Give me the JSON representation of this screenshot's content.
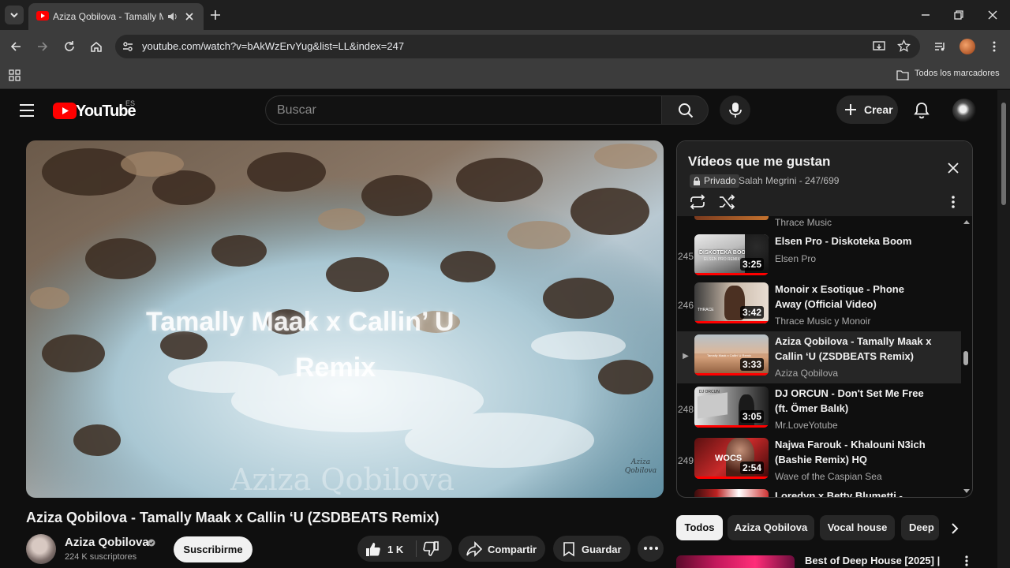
{
  "browser": {
    "tab_title": "Aziza Qobilova - Tamally Maak x Callin ‘U (ZSDBEATS Remix)",
    "url": "youtube.com/watch?v=bAkWzErvYug&list=LL&index=247",
    "bookmarks_label": "Todos los marcadores"
  },
  "header": {
    "logo_text": "YouTube",
    "region": "ES",
    "search_placeholder": "Buscar",
    "create_label": "Crear"
  },
  "video": {
    "overlay_line1": "Tamally Maak x Callin’ U",
    "overlay_line2": "Remix",
    "watermark": "Aziza Qobilova",
    "corner_mark": "Aziza Qobilova",
    "title": "Aziza Qobilova - Tamally Maak x Callin ‘U (ZSDBEATS Remix)",
    "channel": "Aziza Qobilova",
    "subscribers": "224 K suscriptores",
    "subscribe_label": "Suscribirme",
    "like_count": "1 K",
    "share_label": "Compartir",
    "save_label": "Guardar"
  },
  "playlist": {
    "title": "Vídeos que me gustan",
    "privacy": "Privado",
    "owner_position": "Salah Megrini - 247/699",
    "top_partial_channel": "Thrace Music",
    "items": [
      {
        "index": "245",
        "title": "Elsen Pro - Diskoteka Boom",
        "channel": "Elsen Pro",
        "duration": "3:25",
        "thumb_text": "DISKOTEKA BOOM",
        "thumb_sub": "ELSEN PRO REMIX"
      },
      {
        "index": "246",
        "title": "Monoir x Esotique - Phone Away (Official Video)",
        "channel": "Thrace Music y Monoir",
        "duration": "3:42",
        "thumb_text": "THRACE"
      },
      {
        "index": "▶",
        "title": "Aziza Qobilova - Tamally Maak x Callin ‘U (ZSDBEATS Remix)",
        "channel": "Aziza Qobilova",
        "duration": "3:33",
        "thumb_text": "Tamally Maak x Callin' U Remix"
      },
      {
        "index": "248",
        "title": "DJ ORCUN - Don't Set Me Free (ft. Ömer Balık)",
        "channel": "Mr.LoveYotube",
        "duration": "3:05",
        "thumb_text": "DJ ORCUN"
      },
      {
        "index": "249",
        "title": "Najwa Farouk - Khalouni N3ich (Bashie Remix) HQ",
        "channel": "Wave of the Caspian Sea",
        "duration": "2:54",
        "thumb_text": "WOCS"
      }
    ],
    "partial_last_title": "Loredyn x Betty Blumetti -"
  },
  "chips": [
    "Todos",
    "Aziza Qobilova",
    "Vocal house",
    "Deep"
  ],
  "recommendation": {
    "title": "Best of Deep House [2025] |"
  },
  "colors": {
    "accent_red": "#ff0000",
    "background": "#0f0f0f",
    "surface": "#272727",
    "chrome": "#3c3c3c"
  }
}
